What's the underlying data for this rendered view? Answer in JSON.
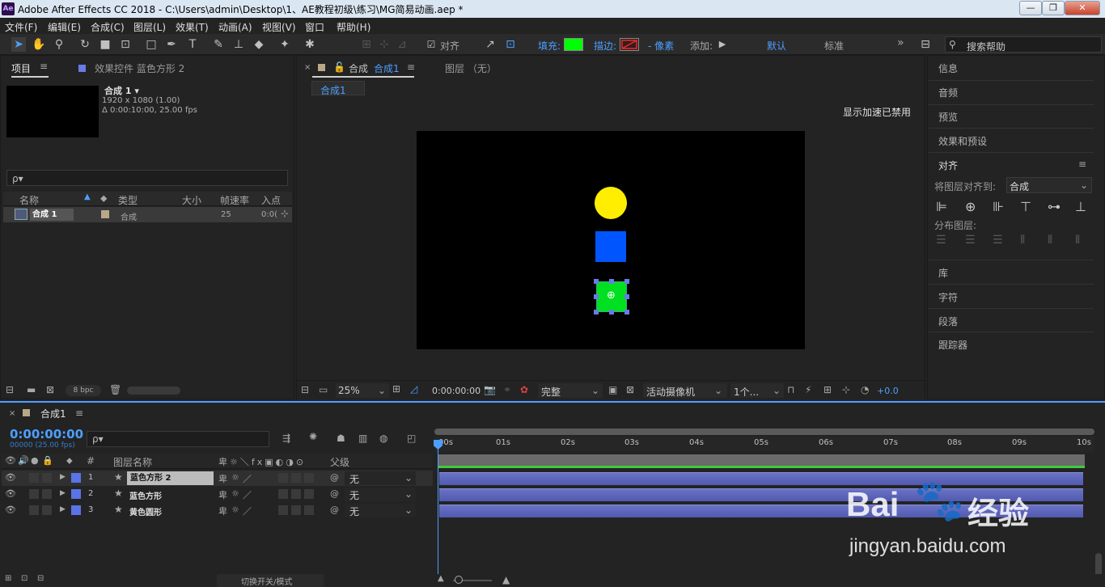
{
  "window": {
    "title": "Adobe After Effects CC 2018 - C:\\Users\\admin\\Desktop\\1、AE教程初级\\练习\\MG简易动画.aep *",
    "logo": "Ae",
    "minimize": "—",
    "maximize": "❐",
    "close": "✕"
  },
  "menu": [
    "文件(F)",
    "编辑(E)",
    "合成(C)",
    "图层(L)",
    "效果(T)",
    "动画(A)",
    "视图(V)",
    "窗口",
    "帮助(H)"
  ],
  "toolbar": {
    "align_label": "对齐",
    "fill_label": "填充:",
    "stroke_label": "描边:",
    "stroke_px": "- 像素",
    "add_label": "添加:",
    "workspace_default": "默认",
    "workspace_standard": "标准",
    "more": "»",
    "search_help_placeholder": "搜索帮助",
    "fill_color": "#00ff00",
    "accent": "#4d9fff"
  },
  "project_panel": {
    "tab_project": "项目",
    "tab_effects": "效果控件 蓝色方形 2",
    "comp_name": "合成 1 ▾",
    "comp_info1": "1920 x 1080 (1.00)",
    "comp_info2": "Δ 0:00:10:00, 25.00 fps",
    "search_placeholder": "ρ▾",
    "columns": {
      "name": "名称",
      "type": "类型",
      "size": "大小",
      "fps": "帧速率",
      "in": "入点"
    },
    "row": {
      "name": "合成 1",
      "type": "合成",
      "fps": "25",
      "in": "0:0("
    },
    "bpc": "8 bpc"
  },
  "comp_panel": {
    "tab_label": "合成",
    "tab_comp_name": "合成1",
    "layer_tab": "图层 （无）",
    "sub_tab": "合成1",
    "gpu_notice": "显示加速已禁用",
    "zoom": "25%",
    "timecode": "0:00:00:00",
    "quality": "完整",
    "camera": "活动摄像机",
    "views": "1个...",
    "exposure": "+0.0",
    "shapes": {
      "circle_color": "#ffee00",
      "square_color": "#0055ff",
      "green_color": "#00e020"
    }
  },
  "right_panels": {
    "info": "信息",
    "audio": "音频",
    "preview": "预览",
    "effects_presets": "效果和预设",
    "align": "对齐",
    "align_to_label": "将图层对齐到:",
    "align_to_value": "合成",
    "distribute": "分布图层:",
    "library": "库",
    "character": "字符",
    "paragraph": "段落",
    "tracker": "跟踪器"
  },
  "timeline": {
    "tab_label": "合成1",
    "timecode": "0:00:00:00",
    "frame_info": "00000 (25.00 fps)",
    "search_placeholder": "ρ▾",
    "col_layer_name": "图层名称",
    "col_num": "#",
    "col_parent": "父级",
    "switch_mode": "切换开关/模式",
    "ruler": [
      "00s",
      "01s",
      "02s",
      "03s",
      "04s",
      "05s",
      "06s",
      "07s",
      "08s",
      "09s",
      "10s"
    ],
    "layers": [
      {
        "num": "1",
        "name": "蓝色方形 2",
        "parent": "无",
        "color": "#5a73e6"
      },
      {
        "num": "2",
        "name": "蓝色方形",
        "parent": "无",
        "color": "#5a73e6"
      },
      {
        "num": "3",
        "name": "黄色圆形",
        "parent": "无",
        "color": "#5a73e6"
      }
    ]
  },
  "watermark": {
    "brand": "Bai",
    "brand_suffix": "经验",
    "url": "jingyan.baidu.com"
  }
}
